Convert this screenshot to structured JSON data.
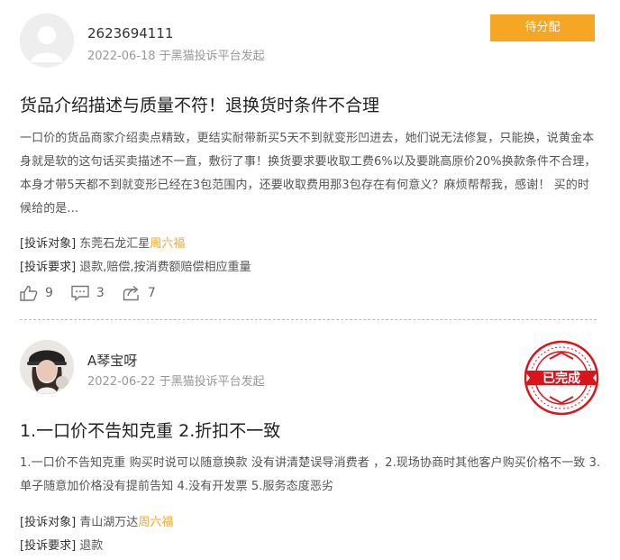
{
  "complaints": [
    {
      "user": "2623694111",
      "meta": "2022-06-18 于黑猫投诉平台发起",
      "status": "待分配",
      "title": "货品介绍描述与质量不符！退换货时条件不合理",
      "summary": "一口价的货品商家介绍卖点精致，更结实耐带新买5天不到就变形凹进去，她们说无法修复，只能换，说黄金本身就是软的这句话买卖描述不一直，敷衍了事！换货要求要收取工费6%以及要跳高原价20%换款条件不合理，本身才带5天都不到就变形已经在3包范围内，还要收取费用那3包存在有何意义？麻烦帮帮我，感谢！ 买的时候给的是...",
      "target_label": "[投诉对象]",
      "target_name": "东莞石龙汇星",
      "target_brand": "周六福",
      "demand_label": "[投诉要求]",
      "demand": "退款,赔偿,按消费额赔偿相应重量",
      "likes": "9",
      "comments": "3",
      "shares": "7"
    },
    {
      "user": "A琴宝呀",
      "meta": "2022-06-22 于黑猫投诉平台发起",
      "status": "已完成",
      "title": "1.一口价不告知克重 2.折扣不一致",
      "summary": "1.一口价不告知克重 购买时说可以随意换款 没有讲清楚误导消费者 ，2.现场协商时其他客户购买价格不一致 3.单子随意加价格没有提前告知 4.没有开发票 5.服务态度恶劣",
      "target_label": "[投诉对象]",
      "target_name": "青山湖万达",
      "target_brand": "周六福",
      "demand_label": "[投诉要求]",
      "demand": "退款"
    }
  ],
  "colors": {
    "accent": "#f5a623",
    "stamp_red": "#d9151b"
  },
  "icons": [
    "thumbs-up-icon",
    "comment-icon",
    "share-icon",
    "user-avatar",
    "completed-stamp"
  ]
}
